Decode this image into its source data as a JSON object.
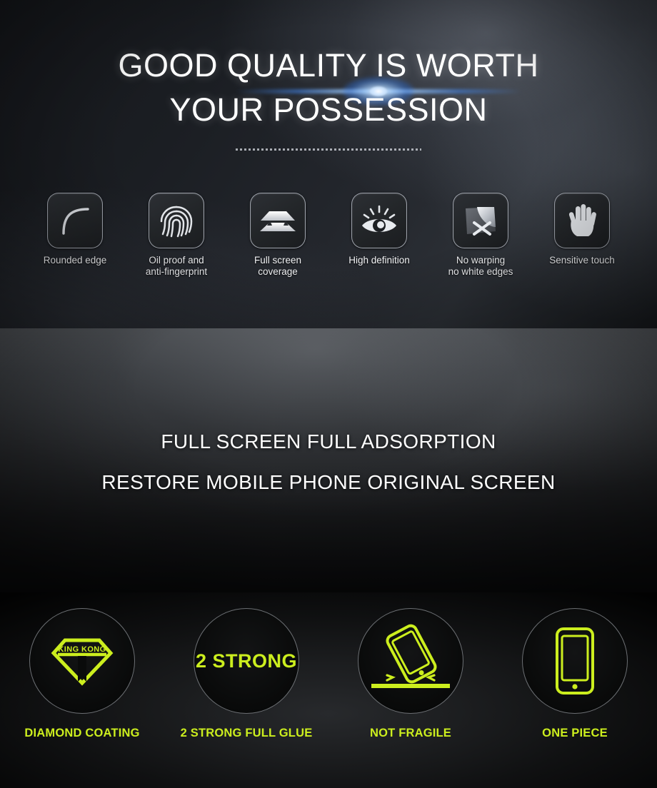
{
  "colors": {
    "accent_green": "#ccee1e",
    "hero_bg_dark": "#16181c",
    "hero_bg_light": "#2c3036",
    "mid_bg_top": "#4a4d51",
    "bottom_bg": "#0a0b0c",
    "text_white": "#ffffff",
    "flare_blue": "#2d6ed7",
    "icon_box_border": "#c8ced8"
  },
  "hero": {
    "title_line1": "GOOD QUALITY IS WORTH",
    "title_line2": "YOUR POSSESSION",
    "divider": "dotted-divider",
    "flare": "lens-flare",
    "features": [
      {
        "icon": "rounded-edge-icon",
        "label": "Rounded edge"
      },
      {
        "icon": "fingerprint-icon",
        "label": "Oil proof and\nanti-fingerprint"
      },
      {
        "icon": "full-coverage-icon",
        "label": "Full screen\ncoverage"
      },
      {
        "icon": "eye-icon",
        "label": "High definition"
      },
      {
        "icon": "no-warping-icon",
        "label": "No warping\nno white edges"
      },
      {
        "icon": "hand-icon",
        "label": "Sensitive touch"
      }
    ]
  },
  "mid": {
    "line1": "FULL SCREEN FULL ADSORPTION",
    "line2": "RESTORE MOBILE PHONE ORIGINAL SCREEN"
  },
  "bottom": {
    "items": [
      {
        "icon": "diamond-king-kong-icon",
        "badge_text": "KING KONG",
        "label": "DIAMOND COATING"
      },
      {
        "icon": "two-strong-text-icon",
        "badge_text": "2 STRONG",
        "label": "2 STRONG FULL GLUE"
      },
      {
        "icon": "drop-phone-icon",
        "badge_text": "",
        "label": "NOT FRAGILE"
      },
      {
        "icon": "one-piece-phone-icon",
        "badge_text": "",
        "label": "ONE PIECE"
      }
    ]
  }
}
